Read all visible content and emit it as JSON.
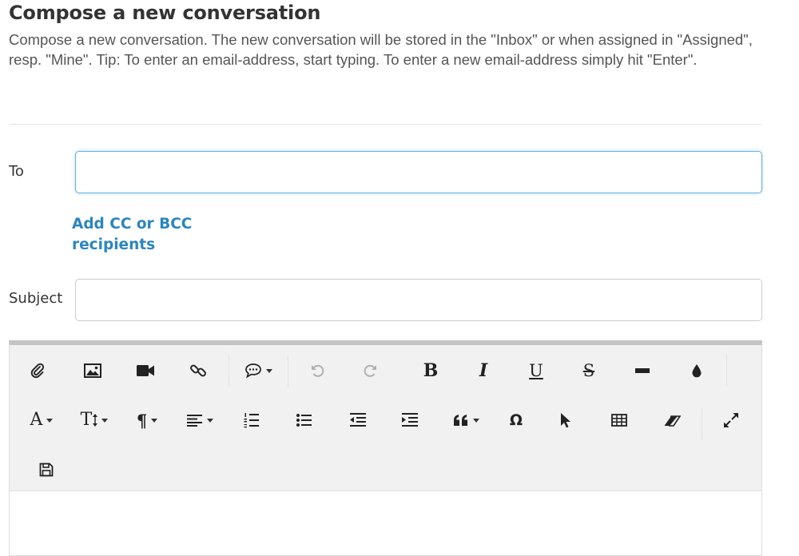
{
  "page": {
    "title": "Compose a new conversation",
    "description": "Compose a new conversation. The new conversation will be stored in the \"Inbox\" or when assigned in \"Assigned\", resp. \"Mine\". Tip: To enter an email-address, start typing. To enter a new email-address simply hit \"Enter\"."
  },
  "form": {
    "to_label": "To",
    "to_value": "",
    "cc_bcc_link": "Add CC or BCC recipients",
    "subject_label": "Subject",
    "subject_value": ""
  },
  "editor": {
    "content": "",
    "toolbar_row1": [
      "attach-file",
      "insert-image",
      "insert-video",
      "insert-link",
      "comment",
      "undo",
      "redo",
      "bold",
      "italic",
      "underline",
      "strikethrough",
      "horizontal-rule",
      "text-color"
    ],
    "toolbar_row2": [
      "font-family",
      "font-size",
      "paragraph-format",
      "align",
      "ordered-list",
      "unordered-list",
      "outdent",
      "indent",
      "quote",
      "special-characters",
      "select-all",
      "insert-table",
      "clear-formatting",
      "fullscreen"
    ],
    "toolbar_row3": [
      "save"
    ],
    "glyphs": {
      "bold": "B",
      "italic": "I",
      "underline": "U",
      "strikethrough": "S",
      "font_family": "A",
      "font_size": "T",
      "paragraph": "¶",
      "omega": "Ω"
    }
  }
}
